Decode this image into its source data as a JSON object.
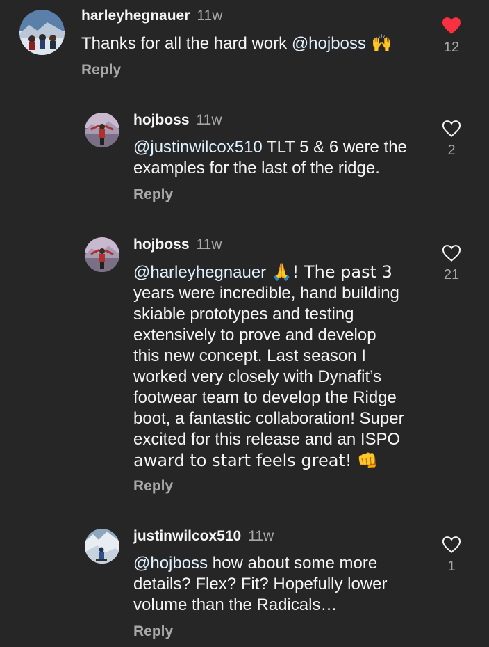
{
  "comments": [
    {
      "username": "harleyhegnauer",
      "time": "11w",
      "mention": "@hojboss",
      "text_before": "Thanks for all the hard work ",
      "text_after": " 🙌",
      "reply_label": "Reply",
      "likes": "12",
      "liked": true,
      "avatar_icon": "avatar-photo-group-snow"
    },
    {
      "username": "hojboss",
      "time": "11w",
      "mention": "@justinwilcox510",
      "text_line1_after_mention": " TLT 5 & 6 were the",
      "text_line2": "examples for the last of the ridge.",
      "reply_label": "Reply",
      "likes": "2",
      "liked": false,
      "avatar_icon": "avatar-photo-person-mountain"
    },
    {
      "username": "hojboss",
      "time": "11w",
      "mention": "@harleyhegnauer",
      "line1_after_mention": " 🙏! The past 3",
      "lines": [
        "years were incredible, hand building",
        "skiable prototypes and testing",
        "extensively to prove and develop",
        "this new concept. Last season I",
        "worked very closely with Dynafit’s",
        "footwear team to develop the Ridge",
        "boot, a fantastic collaboration! Super",
        "excited for this release and an ISPO",
        "award to start feels great! 👊"
      ],
      "reply_label": "Reply",
      "likes": "21",
      "liked": false,
      "avatar_icon": "avatar-photo-person-mountain"
    },
    {
      "username": "justinwilcox510",
      "time": "11w",
      "mention": "@hojboss",
      "line1_after_mention": " how about some more",
      "lines": [
        "details? Flex? Fit? Hopefully lower",
        "volume than the Radicals…"
      ],
      "reply_label": "Reply",
      "likes": "1",
      "liked": false,
      "avatar_icon": "avatar-photo-skier-snow"
    }
  ],
  "colors": {
    "background": "#262626",
    "text": "#f5f5f5",
    "muted": "#a8a8a8",
    "mention": "#e0f1ff",
    "heart_liked": "#ff3040"
  }
}
